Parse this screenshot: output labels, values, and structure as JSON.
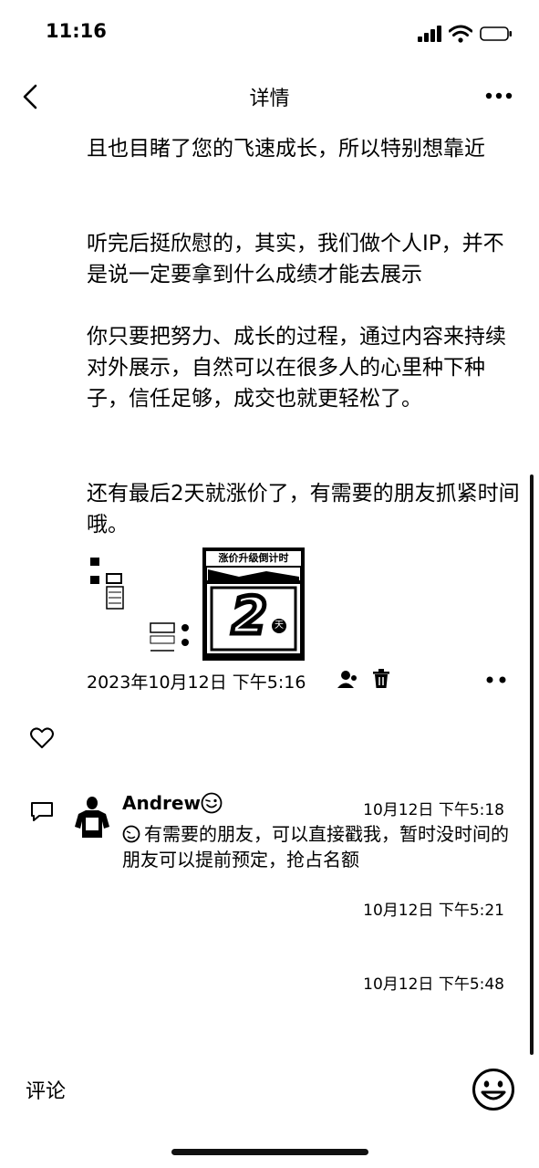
{
  "status_bar": {
    "time": "11:16"
  },
  "nav": {
    "title": "详情"
  },
  "post": {
    "paragraphs": [
      "且也目睹了您的飞速成长，所以特别想靠近",
      "听完后挺欣慰的，其实，我们做个人IP，并不是说一定要拿到什么成绩才能去展示",
      "你只要把努力、成长的过程，通过内容来持续对外展示，自然可以在很多人的心里种下种子，信任足够，成交也就更轻松了。",
      "还有最后2天就涨价了，有需要的朋友抓紧时间哦。"
    ],
    "image_banner": "涨价升级倒计时",
    "image_number": "2",
    "image_number_suffix": "天",
    "date": "2023年10月12日 下午5:16"
  },
  "comments": [
    {
      "author": "Andrew",
      "time": "10月12日 下午5:18",
      "text": "有需要的朋友，可以直接戳我，暂时没时间的朋友可以提前预定，抢占名额"
    },
    {
      "time": "10月12日 下午5:21"
    },
    {
      "time": "10月12日 下午5:48"
    }
  ],
  "footer": {
    "comment_label": "评论"
  }
}
